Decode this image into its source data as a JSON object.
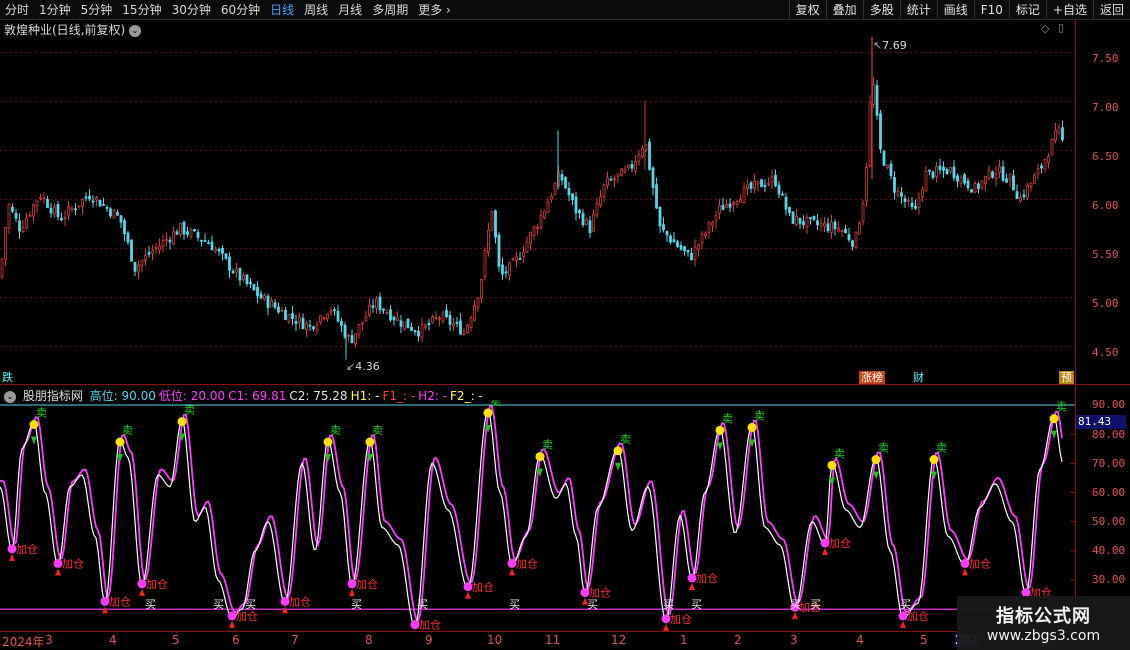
{
  "toolbar": {
    "periods": [
      "分时",
      "1分钟",
      "5分钟",
      "15分钟",
      "30分钟",
      "60分钟",
      "日线",
      "周线",
      "月线",
      "多周期",
      "更多"
    ],
    "active_period": "日线",
    "buttons": [
      "复权",
      "叠加",
      "多股",
      "统计",
      "画线",
      "F10",
      "标记",
      "+自选",
      "返回"
    ]
  },
  "stock": {
    "title": "敦煌种业(日线,前复权)",
    "high_label": "7.69",
    "low_label": "4.36",
    "price_axis": [
      "7.50",
      "7.00",
      "6.50",
      "6.00",
      "5.50",
      "5.00",
      "4.50"
    ],
    "badges": [
      "跌",
      "涨榜",
      "财",
      "预"
    ]
  },
  "indicator": {
    "name": "股朋指标网",
    "legend": [
      {
        "text": "高位: 90.00",
        "color": "#4fd8e8"
      },
      {
        "text": "低位: 20.00",
        "color": "#ff3dff"
      },
      {
        "text": "C1: 69.81",
        "color": "#ff3dff"
      },
      {
        "text": "C2: 75.28",
        "color": "#e6e6e6"
      },
      {
        "text": "H1: -",
        "color": "#ffff40"
      },
      {
        "text": "F1_: -",
        "color": "#ff4040"
      },
      {
        "text": "H2: -",
        "color": "#ff3dff"
      },
      {
        "text": "F2_: -",
        "color": "#ffff40"
      }
    ],
    "axis": [
      "90.00",
      "80.00",
      "70.00",
      "60.00",
      "50.00",
      "40.00",
      "30.00"
    ],
    "current_value": "81.43",
    "buy_label": "买",
    "sell_label": "卖",
    "add_label": "加仓"
  },
  "dates": [
    "2024年",
    "3",
    "4",
    "5",
    "6",
    "7",
    "8",
    "9",
    "10",
    "11",
    "12",
    "1",
    "2",
    "3",
    "4",
    "5",
    "202"
  ],
  "watermark": {
    "title": "指标公式网",
    "url": "www.zbgs3.com"
  },
  "colors": {
    "up": "#ff3c3c",
    "down": "#54ffff",
    "magenta": "#ff3dff",
    "cyan_line": "#4fd8e8"
  }
}
